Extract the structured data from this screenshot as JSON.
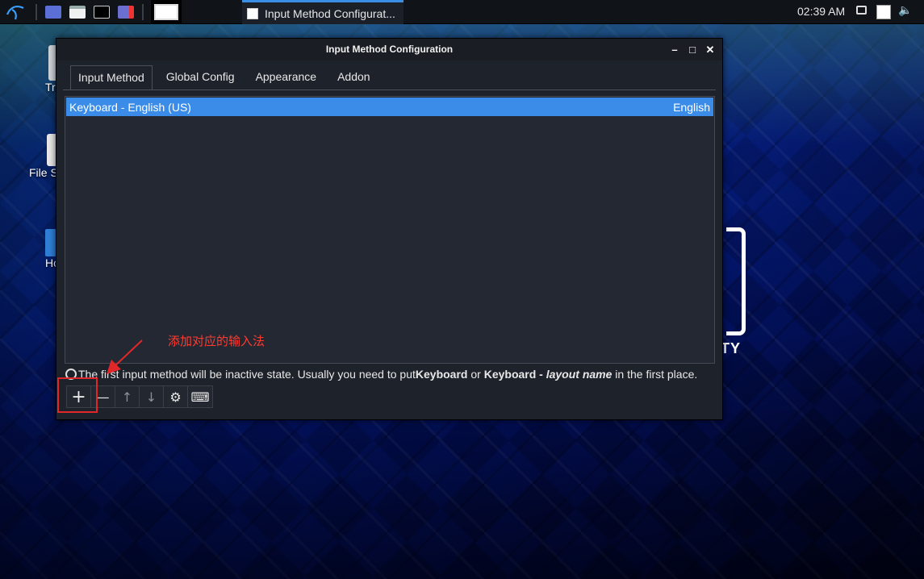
{
  "taskbar": {
    "active_task_title": "Input Method Configurat...",
    "clock": "02:39 AM",
    "icons": [
      "kali-menu-icon",
      "workspace-icon",
      "file-manager-icon",
      "terminal-icon",
      "screenshot-icon"
    ]
  },
  "desktop": {
    "icons": [
      {
        "name": "trash",
        "label": "Tr"
      },
      {
        "name": "file-system",
        "label": "File S"
      },
      {
        "name": "home",
        "label": "Ho"
      }
    ],
    "logo_text": "TY"
  },
  "window": {
    "title": "Input Method Configuration",
    "controls": {
      "minimize": "–",
      "maximize": "□",
      "close": "✕"
    },
    "tabs": [
      {
        "label": "Input Method",
        "active": true
      },
      {
        "label": "Global Config",
        "active": false
      },
      {
        "label": "Appearance",
        "active": false
      },
      {
        "label": "Addon",
        "active": false
      }
    ],
    "list": [
      {
        "name": "Keyboard - English (US)",
        "language": "English",
        "selected": true
      }
    ],
    "info": {
      "prefix": "The first input method will be inactive state. Usually you need to put ",
      "bold1": "Keyboard",
      "middle": " or ",
      "bold2": "Keyboard - ",
      "italic": "layout name",
      "suffix": " in the first place."
    },
    "toolbar": {
      "add": "+",
      "remove": "—",
      "up": "↑",
      "down": "↓",
      "configure": "⚙",
      "keyboard": "⌨"
    }
  },
  "annotation": {
    "text": "添加对应的输入法",
    "color": "#ff3b30"
  }
}
